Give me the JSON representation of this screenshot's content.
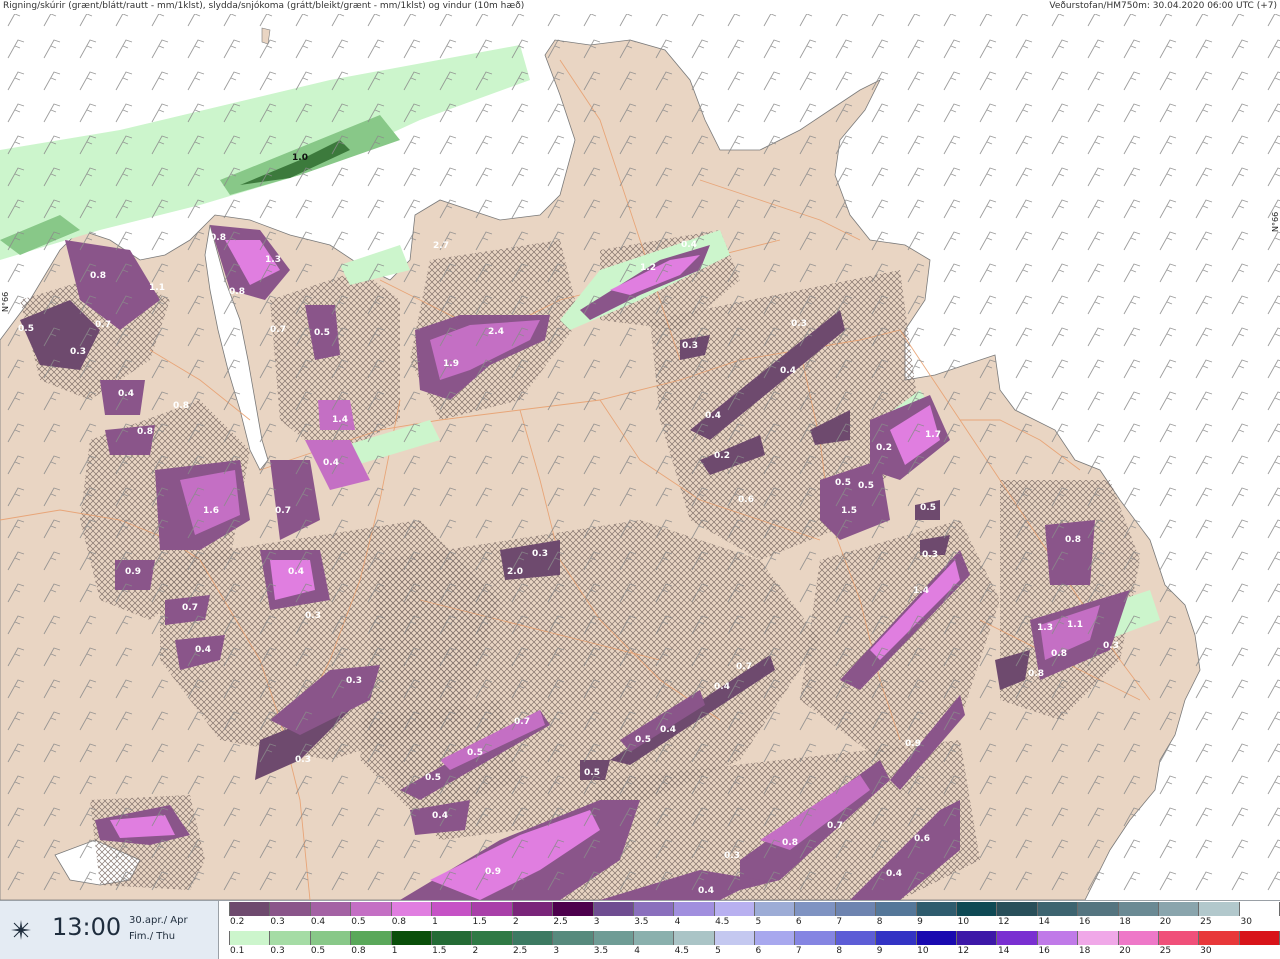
{
  "header": {
    "title_left": "Rigning/skúrir (grænt/blátt/rautt - mm/1klst), slydda/snjókoma (grátt/bleikt/grænt - mm/1klst) og vindur (10m hæð)",
    "title_right": "Veðurstofan/HM750m: 30.04.2020 06:00 UTC (+7)"
  },
  "map": {
    "lat_label_left": "N°66",
    "lat_label_right": "N°66",
    "colors": {
      "sea": "#ffffff",
      "land": "#e9d5c3",
      "roads": "#e8a070",
      "wind_barb": "#8a8a8a"
    },
    "value_labels": [
      "1.0",
      "0.8",
      "1.3",
      "0.8",
      "0.8",
      "1.1",
      "0.5",
      "0.7",
      "0.3",
      "0.7",
      "0.5",
      "0.4",
      "0.8",
      "0.8",
      "1.4",
      "0.4",
      "2.7",
      "1.9",
      "2.4",
      "1.2",
      "0.4",
      "0.3",
      "0.3",
      "0.4",
      "0.4",
      "0.2",
      "0.6",
      "0.5",
      "0.5",
      "1.5",
      "1.7",
      "0.2",
      "0.5",
      "0.3",
      "0.3",
      "2.0",
      "1.6",
      "0.7",
      "0.9",
      "0.4",
      "0.7",
      "0.3",
      "0.4",
      "0.3",
      "0.7",
      "0.4",
      "0.4",
      "0.5",
      "0.5",
      "0.5",
      "0.4",
      "0.5",
      "0.3",
      "0.7",
      "1.4",
      "0.8",
      "1.3",
      "1.1",
      "0.8",
      "0.8",
      "0.3",
      "0.9",
      "0.7",
      "0.8",
      "0.3",
      "0.4",
      "0.6",
      "0.9",
      "0.4"
    ]
  },
  "footer": {
    "icon": "sun-icon",
    "time": "13:00",
    "date_line1": "30.apr./ Apr",
    "date_line2": "Fim./ Thu",
    "snow_scale": {
      "labels": [
        "0.2",
        "0.3",
        "0.4",
        "0.5",
        "0.8",
        "1",
        "1.5",
        "2",
        "2.5",
        "3",
        "3.5",
        "4",
        "4.5",
        "5",
        "6",
        "7",
        "8",
        "9",
        "10",
        "12",
        "14",
        "16",
        "18",
        "20",
        "25",
        "30"
      ],
      "colors": [
        "#6e4a6e",
        "#8a558a",
        "#a462a4",
        "#c46fc4",
        "#e07ee0",
        "#c652c6",
        "#a93fa9",
        "#7a257a",
        "#4d004d",
        "#6f4d91",
        "#8a6fbd",
        "#a18fde",
        "#b8b0f0",
        "#9dacd6",
        "#7f93c2",
        "#6e84b0",
        "#557799",
        "#2f5c6e",
        "#0f4a55",
        "#294f5a",
        "#3d6470",
        "#557580",
        "#6b8a94",
        "#8aa5ad",
        "#b2c8cc",
        "#ffffff"
      ]
    },
    "rain_scale": {
      "labels": [
        "0.1",
        "0.3",
        "0.5",
        "0.8",
        "1",
        "1.5",
        "2",
        "2.5",
        "3",
        "3.5",
        "4",
        "4.5",
        "5",
        "6",
        "7",
        "8",
        "9",
        "10",
        "12",
        "14",
        "16",
        "18",
        "20",
        "25",
        "30",
        ""
      ],
      "colors": [
        "#ccf5cc",
        "#a5dca5",
        "#88c888",
        "#5aa85a",
        "#0a4f0a",
        "#246b35",
        "#2f7a45",
        "#3c7a62",
        "#578a7d",
        "#6f9c95",
        "#8ab0ad",
        "#aac4c6",
        "#c4c8f0",
        "#a8a8ee",
        "#8585e2",
        "#5d5dd6",
        "#3333c4",
        "#1a0ab0",
        "#3d18a8",
        "#7a2fd1",
        "#c07ae8",
        "#f0a8e8",
        "#ee78c8",
        "#f0507a",
        "#e8383a",
        "#d8141a"
      ]
    }
  }
}
